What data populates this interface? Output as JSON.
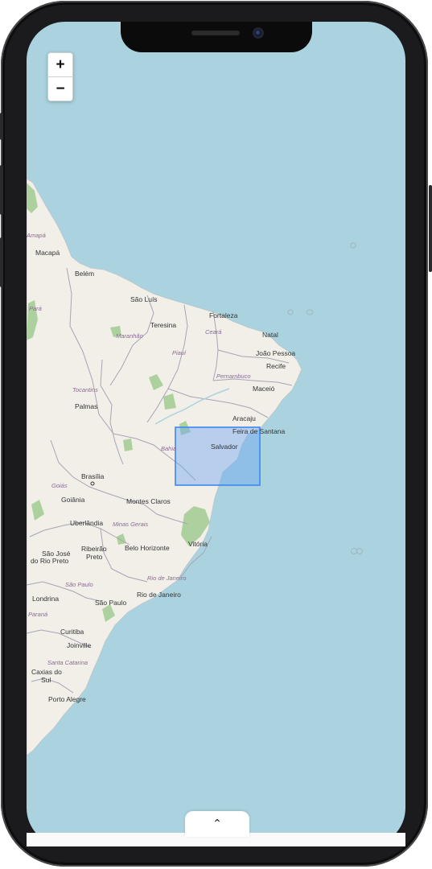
{
  "map": {
    "zoom_in_label": "+",
    "zoom_out_label": "−",
    "cities": [
      {
        "name": "Macapá"
      },
      {
        "name": "Belém"
      },
      {
        "name": "São Luís"
      },
      {
        "name": "Fortaleza"
      },
      {
        "name": "Teresina"
      },
      {
        "name": "Natal"
      },
      {
        "name": "João Pessoa"
      },
      {
        "name": "Recife"
      },
      {
        "name": "Maceió"
      },
      {
        "name": "Aracaju"
      },
      {
        "name": "Feira de Santana"
      },
      {
        "name": "Salvador"
      },
      {
        "name": "Palmas"
      },
      {
        "name": "Brasília"
      },
      {
        "name": "Goiânia"
      },
      {
        "name": "Montes Claros"
      },
      {
        "name": "Uberlândia"
      },
      {
        "name": "São José"
      },
      {
        "name": "do Rio Preto"
      },
      {
        "name": "Ribeirão"
      },
      {
        "name": "Preto"
      },
      {
        "name": "Belo Horizonte"
      },
      {
        "name": "Vitória"
      },
      {
        "name": "Londrina"
      },
      {
        "name": "São Paulo"
      },
      {
        "name": "Rio de Janeiro"
      },
      {
        "name": "Curitiba"
      },
      {
        "name": "Joinville"
      },
      {
        "name": "Caxias do"
      },
      {
        "name": "Sul"
      },
      {
        "name": "Porto Alegre"
      }
    ],
    "states": [
      {
        "name": "Amapá"
      },
      {
        "name": "Pará"
      },
      {
        "name": "Maranhão"
      },
      {
        "name": "Ceará"
      },
      {
        "name": "Piauí"
      },
      {
        "name": "Pernambuco"
      },
      {
        "name": "Tocantins"
      },
      {
        "name": "Bahia"
      },
      {
        "name": "Goiás"
      },
      {
        "name": "Minas Gerais"
      },
      {
        "name": "São Paulo"
      },
      {
        "name": "Rio de Janeiro"
      },
      {
        "name": "Paraná"
      },
      {
        "name": "Santa Catarina"
      }
    ],
    "colors": {
      "ocean": "#aad3df",
      "land": "#f2efe9",
      "forest": "#add19e",
      "border": "#9e9aa9",
      "selection_fill": "#6ea6f0",
      "selection_stroke": "#3d87f2"
    }
  },
  "sheet": {
    "handle_icon": "chevron-up-icon"
  }
}
